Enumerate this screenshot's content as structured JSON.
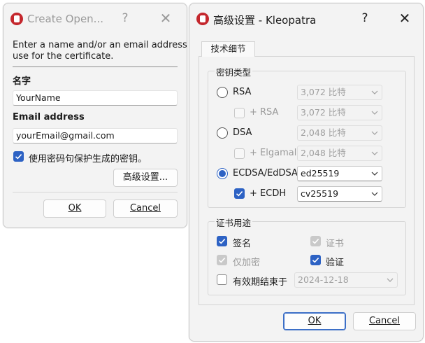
{
  "create_dialog": {
    "title": "Create Open...",
    "help_glyph": "?",
    "close_glyph": "✕",
    "intro_text_line1": "Enter a name and/or an email address to",
    "intro_text_line2": "use for the certificate.",
    "name_label": "名字",
    "name_value": "YourName",
    "email_label": "Email address",
    "email_value": "yourEmail@gmail.com",
    "protect_checkbox_label": "使用密码句保护生成的密钥。",
    "protect_checked": true,
    "advanced_button": "高级设置...",
    "ok_button": "OK",
    "cancel_button": "Cancel"
  },
  "advanced_dialog": {
    "title": "高级设置 - Kleopatra",
    "help_glyph": "?",
    "close_glyph": "✕",
    "tab_label": "技术细节",
    "key_type_group": "密钥类型",
    "rsa_label": "RSA",
    "rsa_size": "3,072 比特",
    "rsa_sub_label": "+ RSA",
    "rsa_sub_size": "3,072 比特",
    "dsa_label": "DSA",
    "dsa_size": "2,048 比特",
    "elgamal_label": "+ Elgamal",
    "elgamal_size": "2,048 比特",
    "ecdsa_label": "ECDSA/EdDSA",
    "ecdsa_curve": "ed25519",
    "ecdh_label": "+ ECDH",
    "ecdh_curve": "cv25519",
    "selected_algorithm": "ECDSA/EdDSA",
    "usage_group": "证书用途",
    "sign_label": "签名",
    "certify_label": "证书",
    "encrypt_only_label": "仅加密",
    "auth_label": "验证",
    "expiry_label": "有效期结束于",
    "expiry_date": "2024-12-18",
    "ok_button": "OK",
    "cancel_button": "Cancel"
  },
  "colors": {
    "accent": "#2d62c4",
    "app_icon": "#c4272d",
    "dialog_bg": "#f3f3f3"
  }
}
